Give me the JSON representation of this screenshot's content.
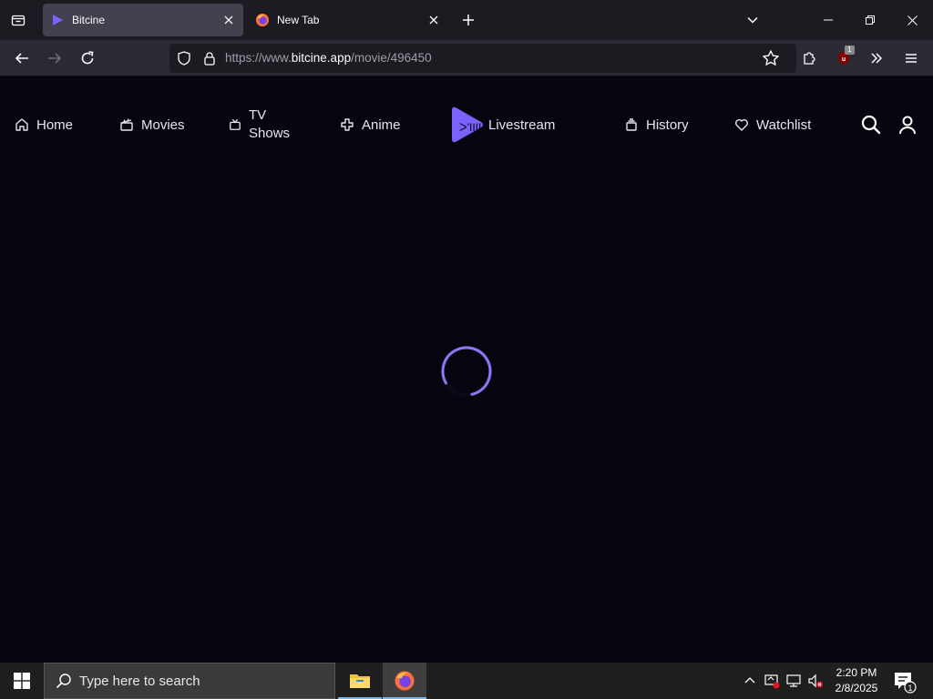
{
  "browser": {
    "tabs": [
      {
        "title": "Bitcine",
        "active": true
      },
      {
        "title": "New Tab",
        "active": false
      }
    ],
    "url": {
      "prefix": "https://www.",
      "host": "bitcine.app",
      "path": "/movie/496450"
    },
    "extension_badge": "1"
  },
  "site": {
    "nav": {
      "home": "Home",
      "movies": "Movies",
      "tv": "TV Shows",
      "anime": "Anime",
      "livestream": "Livestream",
      "history": "History",
      "watchlist": "Watchlist"
    },
    "logo_overlay_text": "ᐳ'IIII",
    "accent_color": "#7b61ff",
    "state": "loading"
  },
  "taskbar": {
    "search_placeholder": "Type here to search",
    "time": "2:20 PM",
    "date": "2/8/2025",
    "notification_count": "1"
  }
}
